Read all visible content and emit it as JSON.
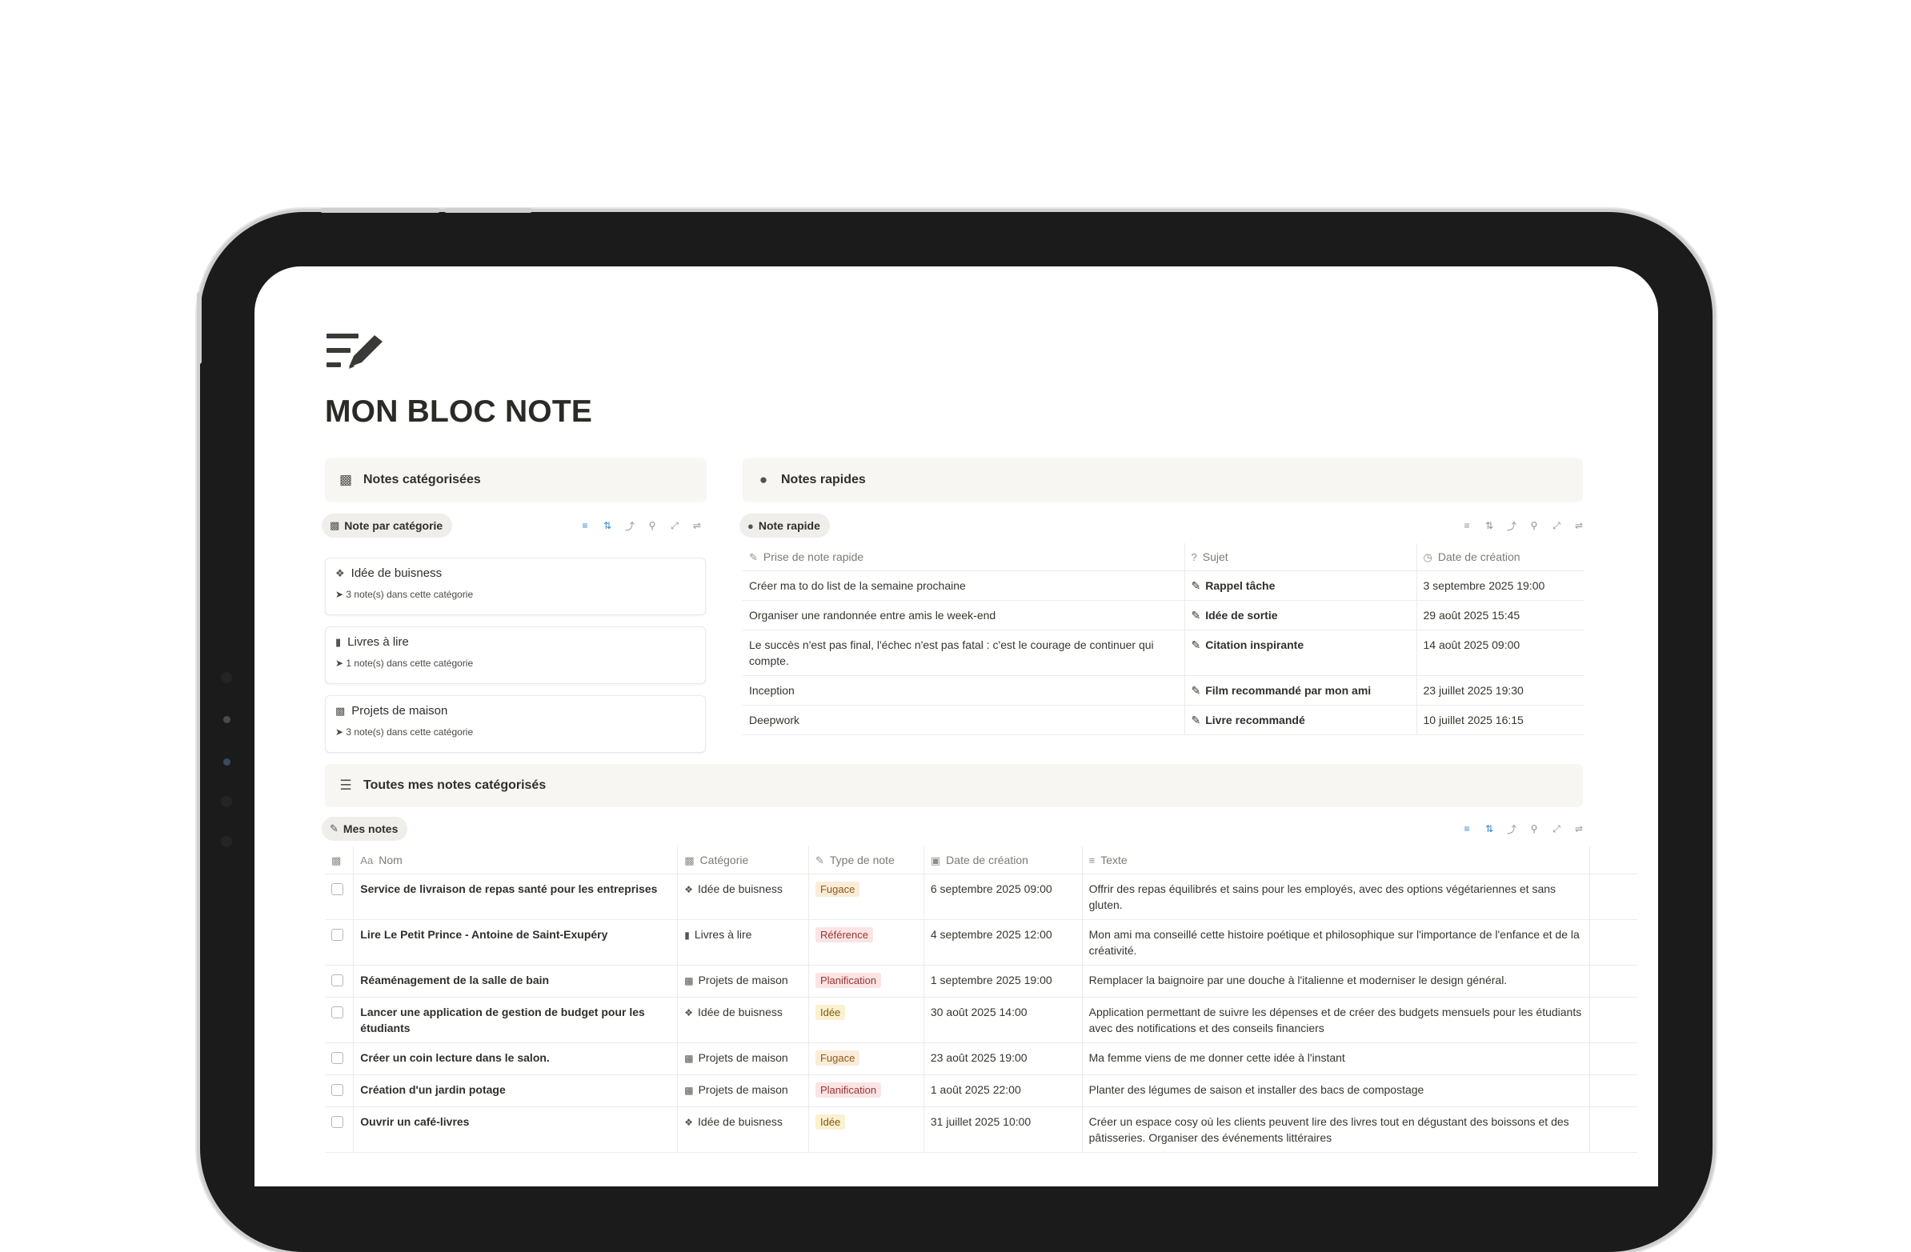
{
  "page": {
    "title": "MON BLOC NOTE",
    "icon": "note-pencil-icon"
  },
  "categorized": {
    "header": "Notes catégorisées",
    "header_icon": "archive-box-icon",
    "view_label": "Note par catégorie",
    "cards": [
      {
        "title": "Idée de buisness",
        "icon": "lightbulb-icon",
        "count": "➤ 3 note(s) dans cette catégorie"
      },
      {
        "title": "Livres à lire",
        "icon": "book-icon",
        "count": "➤ 1 note(s) dans cette catégorie"
      },
      {
        "title": "Projets de maison",
        "icon": "archive-box-icon",
        "count": "➤ 3 note(s) dans cette catégorie"
      }
    ]
  },
  "quick": {
    "header": "Notes rapides",
    "header_icon": "chat-bubbles-icon",
    "view_label": "Note rapide",
    "columns": [
      "Prise de note rapide",
      "Sujet",
      "Date de création"
    ],
    "rows": [
      {
        "note": "Créer ma to do list de la semaine prochaine",
        "subject": "Rappel tâche",
        "date": "3 septembre 2025 19:00"
      },
      {
        "note": "Organiser une randonnée entre amis le week-end",
        "subject": "Idée de sortie",
        "date": "29 août 2025 15:45"
      },
      {
        "note": "Le succès n'est pas final, l'échec n'est pas fatal : c'est le courage de continuer qui compte.",
        "subject": "Citation inspirante",
        "date": "14 août 2025 09:00"
      },
      {
        "note": "Inception",
        "subject": "Film recommandé par mon ami",
        "date": "23 juillet 2025 19:30"
      },
      {
        "note": "Deepwork",
        "subject": "Livre recommandé",
        "date": "10 juillet 2025 16:15"
      }
    ]
  },
  "all_notes": {
    "header": "Toutes mes notes catégorisés",
    "header_icon": "database-icon",
    "view_label": "Mes notes",
    "columns": [
      "Nom",
      "Catégorie",
      "Type de note",
      "Date de création",
      "Texte"
    ],
    "name_prefix": "Aa",
    "rows": [
      {
        "name": "Service de livraison de repas santé pour les entreprises",
        "category": "Idée de buisness",
        "cat_icon": "lightbulb-icon",
        "type": "Fugace",
        "date": "6 septembre 2025 09:00",
        "text": "Offrir des repas équilibrés et sains pour les employés, avec des options végétariennes et sans gluten."
      },
      {
        "name": "Lire Le Petit Prince - Antoine de Saint-Exupéry",
        "category": "Livres à lire",
        "cat_icon": "book-icon",
        "type": "Référence",
        "date": "4 septembre 2025 12:00",
        "text": "Mon ami ma conseillé cette histoire poétique et philosophique sur l'importance de l'enfance et de la créativité."
      },
      {
        "name": "Réaménagement de la salle de bain",
        "category": "Projets de maison",
        "cat_icon": "archive-box-icon",
        "type": "Planification",
        "date": "1 septembre 2025 19:00",
        "text": "Remplacer la baignoire par une douche à l'italienne et moderniser le design général."
      },
      {
        "name": "Lancer une application de gestion de budget pour les étudiants",
        "category": "Idée de buisness",
        "cat_icon": "lightbulb-icon",
        "type": "Idée",
        "date": "30 août 2025 14:00",
        "text": "Application permettant de suivre les dépenses et de créer des budgets mensuels pour les étudiants avec des notifications et des conseils financiers"
      },
      {
        "name": "Créer un coin lecture dans le salon.",
        "category": "Projets de maison",
        "cat_icon": "archive-box-icon",
        "type": "Fugace",
        "date": "23 août 2025 19:00",
        "text": "Ma femme viens de me donner cette idée à l'instant"
      },
      {
        "name": "Création d'un jardin potage",
        "category": "Projets de maison",
        "cat_icon": "archive-box-icon",
        "type": "Planification",
        "date": "1 août 2025 22:00",
        "text": "Planter des légumes de saison et installer des bacs de compostage"
      },
      {
        "name": "Ouvrir un café-livres",
        "category": "Idée de buisness",
        "cat_icon": "lightbulb-icon",
        "type": "Idée",
        "date": "31 juillet 2025 10:00",
        "text": "Créer un espace cosy où les clients peuvent lire des livres tout en dégustant des boissons et des pâtisseries. Organiser des événements littéraires"
      }
    ]
  },
  "tag_colors": {
    "Fugace": {
      "bg": "#fbecd9",
      "fg": "#8a5a16"
    },
    "Référence": {
      "bg": "#fbe4e4",
      "fg": "#9b3333"
    },
    "Planification": {
      "bg": "#fbe4e4",
      "fg": "#9b3333"
    },
    "Idée": {
      "bg": "#fbf0cf",
      "fg": "#7a5b0e"
    }
  }
}
